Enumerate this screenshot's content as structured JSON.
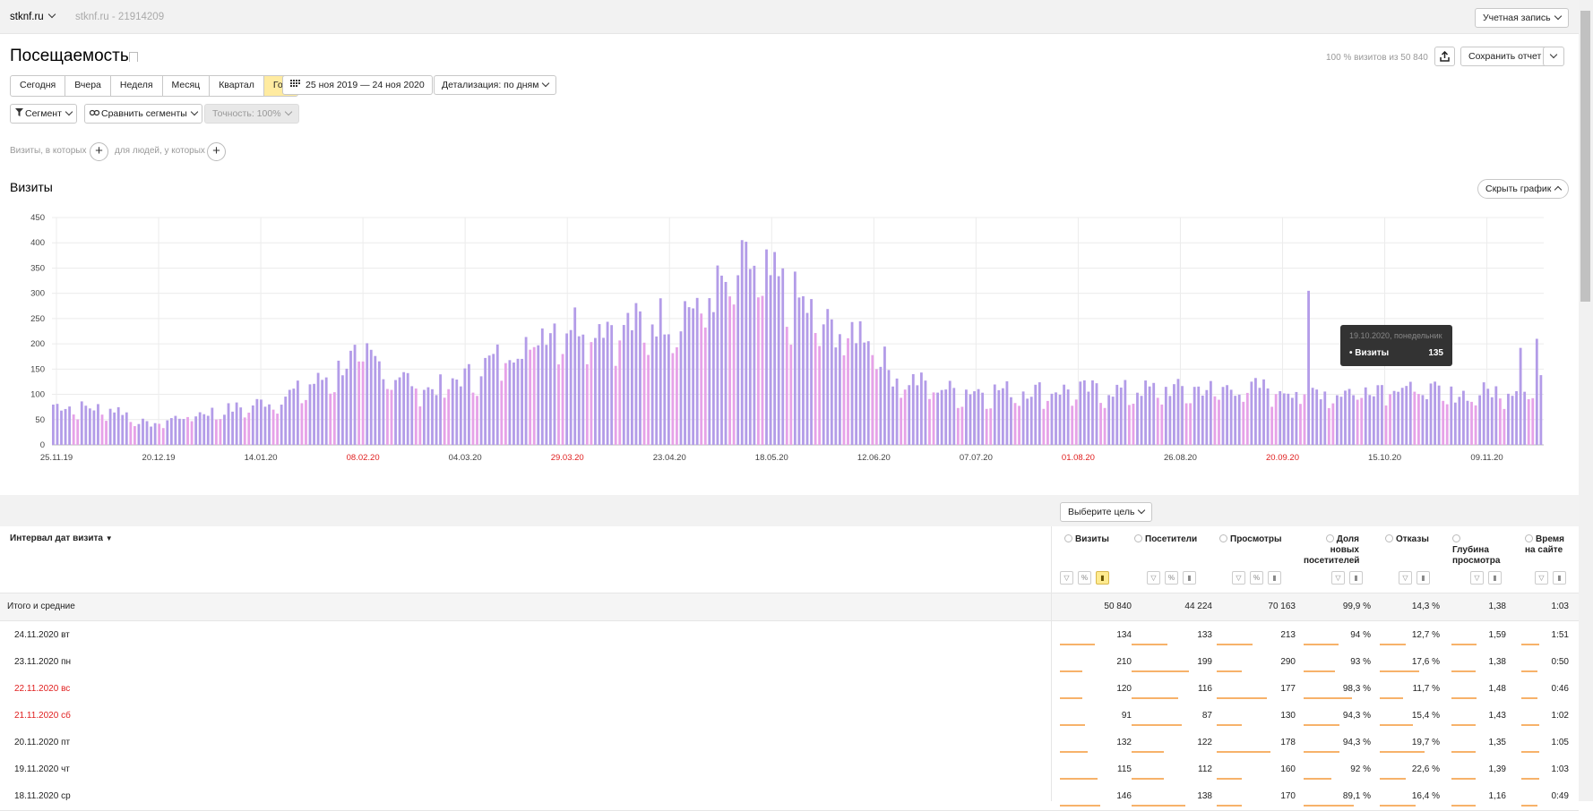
{
  "topbar": {
    "site": "stknf.ru",
    "counter": "stknf.ru - 21914209",
    "account": "Учетная запись"
  },
  "header": {
    "title": "Посещаемость",
    "visits_share": "100 % визитов из 50 840",
    "save": "Сохранить отчет"
  },
  "periods": [
    "Сегодня",
    "Вчера",
    "Неделя",
    "Месяц",
    "Квартал",
    "Год"
  ],
  "active_period": "Год",
  "date_range": "25 ноя 2019 — 24 ноя 2020",
  "detail": "Детализация: по дням",
  "segment": "Сегмент",
  "compare": "Сравнить сегменты",
  "accuracy": "Точность: 100%",
  "filters": {
    "visits": "Визиты, в которых",
    "people": "для людей, у которых"
  },
  "chart_title": "Визиты",
  "hide_chart": "Скрыть график",
  "tooltip": {
    "date": "19.10.2020, понедельник",
    "label": "• Визиты",
    "value": "135"
  },
  "goal": "Выберите цель",
  "chart_data": {
    "type": "bar",
    "title": "Визиты",
    "ylim": [
      0,
      450
    ],
    "yticks": [
      "0",
      "50",
      "100",
      "150",
      "200",
      "250",
      "300",
      "350",
      "400",
      "450"
    ],
    "xticks": [
      "25.11.19",
      "20.12.19",
      "14.01.20",
      "08.02.20",
      "04.03.20",
      "29.03.20",
      "23.04.20",
      "18.05.20",
      "12.06.20",
      "07.07.20",
      "01.08.20",
      "26.08.20",
      "20.09.20",
      "15.10.20",
      "09.11.20"
    ],
    "xticks_red": [
      "08.02.20",
      "29.03.20",
      "01.08.20",
      "20.09.20"
    ],
    "bar_color_weekday": "#b39ce8",
    "bar_color_weekend": "#e6a2e8",
    "grid": true
  },
  "table": {
    "dim_header": "Интервал дат визита",
    "columns": [
      {
        "label": "Визиты"
      },
      {
        "label": "Посетители"
      },
      {
        "label": "Просмотры"
      },
      {
        "label": "Доля новых посетителей"
      },
      {
        "label": "Отказы"
      },
      {
        "label": "Глубина просмотра"
      },
      {
        "label": "Время на сайте"
      }
    ],
    "total": {
      "label": "Итого и средние",
      "values": [
        "50 840",
        "44 224",
        "70 163",
        "99,9 %",
        "14,3 %",
        "1,38",
        "1:03"
      ]
    },
    "rows": [
      {
        "date": "24.11.2020 вт",
        "weekend": false,
        "values": [
          "134",
          "133",
          "213",
          "94 %",
          "12,7 %",
          "1,59",
          "1:51"
        ]
      },
      {
        "date": "23.11.2020 пн",
        "weekend": false,
        "values": [
          "210",
          "199",
          "290",
          "93 %",
          "17,6 %",
          "1,38",
          "0:50"
        ]
      },
      {
        "date": "22.11.2020 вс",
        "weekend": true,
        "values": [
          "120",
          "116",
          "177",
          "98,3 %",
          "11,7 %",
          "1,48",
          "0:46"
        ]
      },
      {
        "date": "21.11.2020 сб",
        "weekend": true,
        "values": [
          "91",
          "87",
          "130",
          "94,3 %",
          "15,4 %",
          "1,43",
          "1:02"
        ]
      },
      {
        "date": "20.11.2020 пт",
        "weekend": false,
        "values": [
          "132",
          "122",
          "178",
          "94,3 %",
          "19,7 %",
          "1,35",
          "1:05"
        ]
      },
      {
        "date": "19.11.2020 чт",
        "weekend": false,
        "values": [
          "115",
          "112",
          "160",
          "92 %",
          "22,6 %",
          "1,39",
          "1:03"
        ]
      },
      {
        "date": "18.11.2020 ср",
        "weekend": false,
        "values": [
          "146",
          "138",
          "170",
          "89,1 %",
          "16,4 %",
          "1,16",
          "0:49"
        ]
      }
    ]
  }
}
